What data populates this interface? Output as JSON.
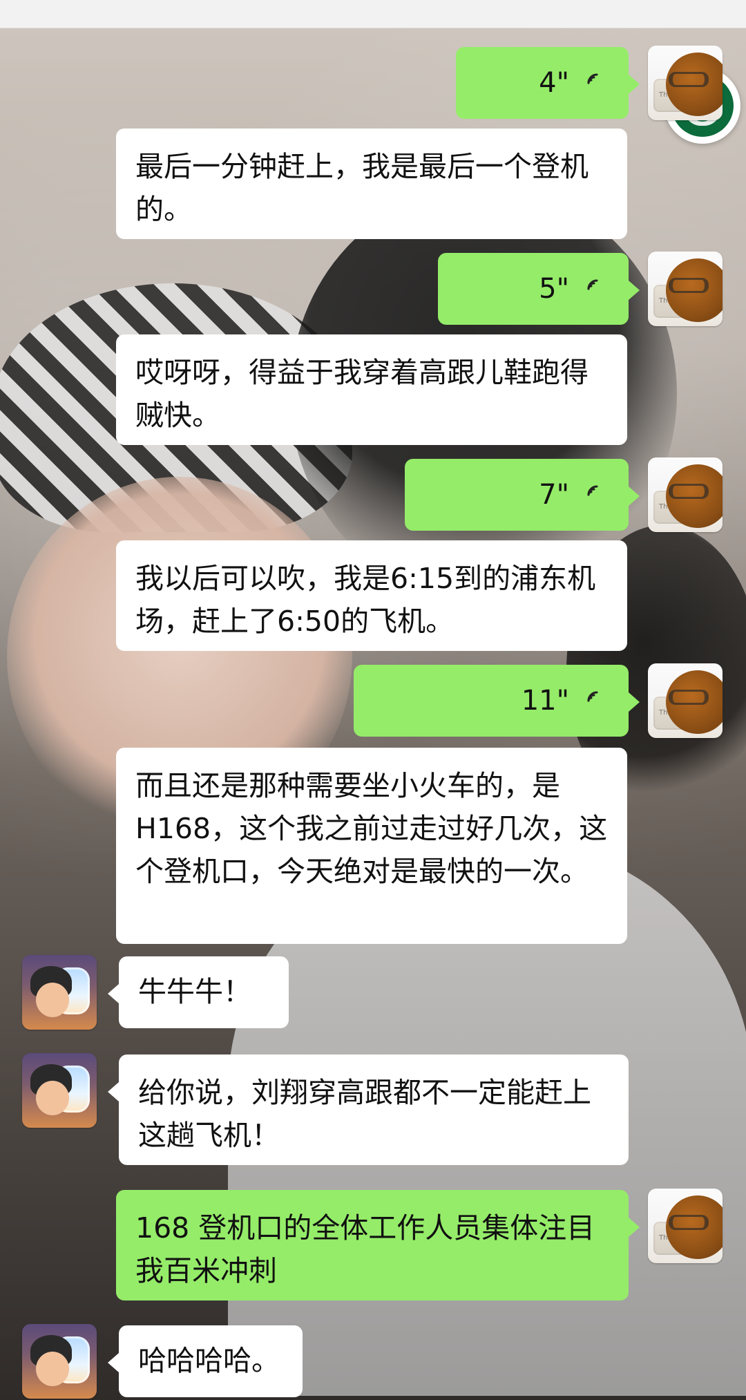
{
  "chat": {
    "messages": [
      {
        "side": "right",
        "type": "voice",
        "duration": "4\""
      },
      {
        "side": "right",
        "type": "text",
        "text": "最后一分钟赶上，我是最后一个登机的。"
      },
      {
        "side": "right",
        "type": "voice",
        "duration": "5\""
      },
      {
        "side": "right",
        "type": "text",
        "text": "哎呀呀，得益于我穿着高跟儿鞋跑得贼快。"
      },
      {
        "side": "right",
        "type": "voice",
        "duration": "7\""
      },
      {
        "side": "right",
        "type": "text",
        "text": "我以后可以吹，我是6:15到的浦东机场，赶上了6:50的飞机。"
      },
      {
        "side": "right",
        "type": "voice",
        "duration": "11\""
      },
      {
        "side": "right",
        "type": "text",
        "text": "而且还是那种需要坐小火车的，是H168，这个我之前过走过好几次，这个登机口，今天绝对是最快的一次。"
      },
      {
        "side": "left",
        "type": "text",
        "text": "牛牛牛！"
      },
      {
        "side": "left",
        "type": "text",
        "text": "给你说，刘翔穿高跟都不一定能赶上这趟飞机！"
      },
      {
        "side": "right",
        "type": "text",
        "text": "168 登机口的全体工作人员集体注目我百米冲刺"
      },
      {
        "side": "left",
        "type": "text",
        "text": "哈哈哈哈。"
      }
    ]
  },
  "icons": {
    "voice": "voice-wave-icon",
    "logo": "starbucks-logo"
  },
  "colors": {
    "bubble_green": "#95ec69",
    "bubble_white": "#ffffff"
  }
}
